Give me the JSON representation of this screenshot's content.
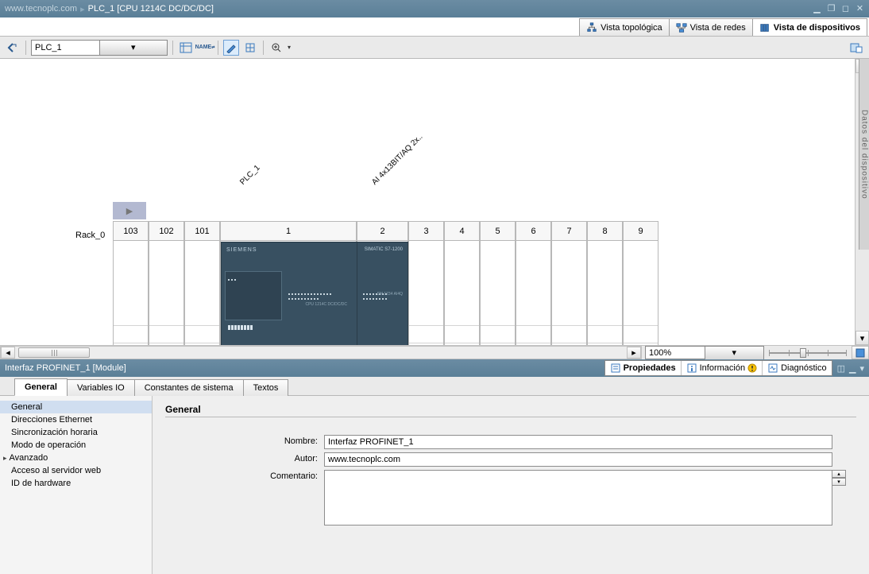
{
  "title": {
    "domain": "www.tecnoplc.com",
    "device": "PLC_1 [CPU 1214C DC/DC/DC]"
  },
  "viewTabs": {
    "topology": "Vista topológica",
    "network": "Vista de redes",
    "device": "Vista de dispositivos"
  },
  "toolbar": {
    "device_select": "PLC_1"
  },
  "canvas": {
    "rack_label": "Rack_0",
    "plc_label": "PLC_1",
    "module2_label": "AI 4x13BIT/AQ 2x..",
    "slots": [
      "103",
      "102",
      "101",
      "1",
      "2",
      "3",
      "4",
      "5",
      "6",
      "7",
      "8",
      "9"
    ],
    "plc_brand": "SIEMENS",
    "plc_series": "SIMATIC S7-1200",
    "plc_cpu": "CPU 1214C\nDC/DC/DC",
    "aq": "SM 1234\nAI4Q"
  },
  "zoom": "100%",
  "sideTab": "Datos del dispositivo",
  "propPanel": {
    "title": "Interfaz PROFINET_1 [Module]",
    "rightTabs": {
      "properties": "Propiedades",
      "info": "Información",
      "diag": "Diagnóstico"
    },
    "catTabs": {
      "general": "General",
      "io": "Variables IO",
      "const": "Constantes de sistema",
      "texts": "Textos"
    },
    "nav": {
      "general": "General",
      "eth": "Direcciones Ethernet",
      "sync": "Sincronización horaria",
      "mode": "Modo de operación",
      "adv": "Avanzado",
      "web": "Acceso al servidor web",
      "hw": "ID de hardware"
    },
    "form": {
      "heading": "General",
      "name_label": "Nombre:",
      "name_value": "Interfaz PROFINET_1",
      "author_label": "Autor:",
      "author_value": "www.tecnoplc.com",
      "comment_label": "Comentario:",
      "comment_value": ""
    }
  }
}
